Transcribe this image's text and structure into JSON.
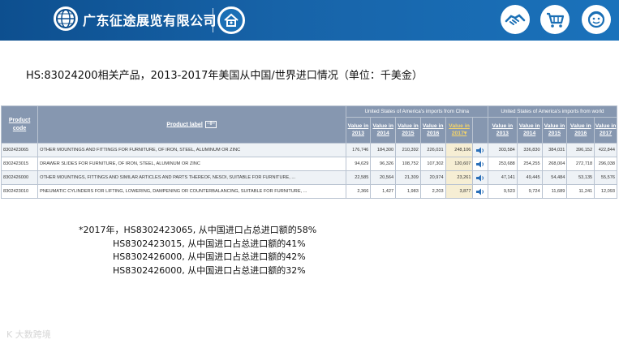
{
  "header": {
    "company": "广东征途展览有限公司",
    "logo_icon": "globe-logo-icon",
    "icons": [
      "handshake-icon",
      "shopping-cart-icon",
      "support-face-icon"
    ],
    "accent": "#1763a8"
  },
  "title": "HS:83024200相关产品，2013-2017年美国从中国/世界进口情况（单位：千美金）",
  "table": {
    "col_code": "Product code",
    "col_label": "Product label",
    "filter_glyph": "⊣⊢",
    "group_china": "United States of America's imports from China",
    "group_world": "United States of America's imports from world",
    "years_china": [
      "Value in 2013",
      "Value in 2014",
      "Value in 2015",
      "Value in 2016",
      "Value in 2017▾"
    ],
    "years_world": [
      "Value in 2013",
      "Value in 2014",
      "Value in 2015",
      "Value in 2016",
      "Value in 2017"
    ],
    "rows": [
      {
        "code": "8302423065",
        "label": "OTHER MOUNTINGS AND FITTINGS FOR FURNITURE, OF IRON, STEEL, ALUMINUM OR ZINC",
        "china": [
          "176,746",
          "184,300",
          "210,392",
          "226,031",
          "248,106"
        ],
        "world": [
          "303,584",
          "336,830",
          "384,031",
          "396,152",
          "422,844"
        ]
      },
      {
        "code": "8302423015",
        "label": "DRAWER SLIDES FOR FURNITURE, OF IRON, STEEL, ALUMINUM OR ZINC",
        "china": [
          "94,629",
          "96,326",
          "108,752",
          "107,302",
          "120,607"
        ],
        "world": [
          "253,688",
          "254,255",
          "268,004",
          "272,718",
          "296,038"
        ]
      },
      {
        "code": "8302426000",
        "label": "OTHER MOUNTINGS, FITTINGS AND SIMILAR ARTICLES AND PARTS THEREOF, NESOI, SUITABLE FOR FURNITURE, ...",
        "china": [
          "22,585",
          "20,564",
          "21,309",
          "20,974",
          "23,261"
        ],
        "world": [
          "47,141",
          "49,445",
          "54,484",
          "53,135",
          "55,576"
        ]
      },
      {
        "code": "8302423010",
        "label": "PNEUMATIC CYLINDERS FOR LIFTING, LOWERING, DAMPENING OR COUNTERBALANCING, SUITABLE FOR FURNITURE, ...",
        "china": [
          "2,366",
          "1,427",
          "1,983",
          "2,203",
          "3,877"
        ],
        "world": [
          "9,523",
          "9,724",
          "11,689",
          "11,241",
          "12,093"
        ]
      }
    ]
  },
  "notes": [
    "*2017年，HS8302423065, 从中国进口占总进口额的58%",
    "            HS8302423015, 从中国进口占总进口额的41%",
    "            HS8302426000, 从中国进口占总进口额的42%",
    "            HS8302426000, 从中国进口占总进口额的32%"
  ],
  "watermark": "K 大数跨境"
}
